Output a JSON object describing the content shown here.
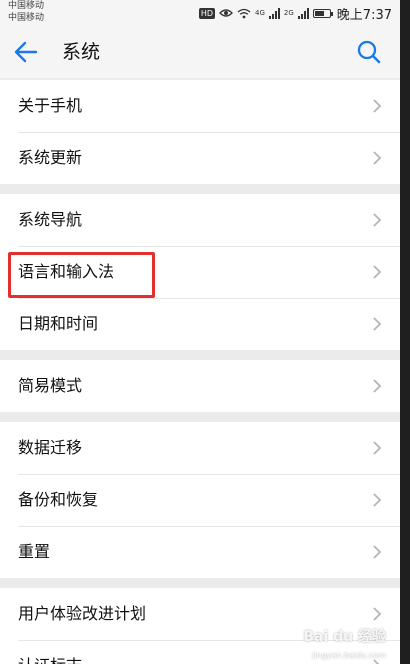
{
  "status_bar": {
    "carrier_1": "中国移动",
    "carrier_2": "中国移动",
    "hd": "HD",
    "net_1": "4G",
    "net_2": "2G",
    "time": "晚上7:37"
  },
  "header": {
    "back_icon": "arrow-left-icon",
    "title": "系统",
    "search_icon": "search-icon",
    "accent_color": "#1a7ae8"
  },
  "groups": [
    {
      "items": [
        {
          "label": "关于手机"
        },
        {
          "label": "系统更新"
        }
      ]
    },
    {
      "items": [
        {
          "label": "系统导航"
        },
        {
          "label": "语言和输入法"
        },
        {
          "label": "日期和时间"
        }
      ]
    },
    {
      "items": [
        {
          "label": "简易模式"
        }
      ]
    },
    {
      "items": [
        {
          "label": "数据迁移"
        },
        {
          "label": "备份和恢复"
        },
        {
          "label": "重置"
        }
      ]
    },
    {
      "items": [
        {
          "label": "用户体验改进计划"
        },
        {
          "label": "认证标志"
        }
      ]
    }
  ],
  "highlight_color": "#e2302f",
  "watermark": {
    "text": "Bai du 经验",
    "sub": "jingyan.baidu.com"
  }
}
